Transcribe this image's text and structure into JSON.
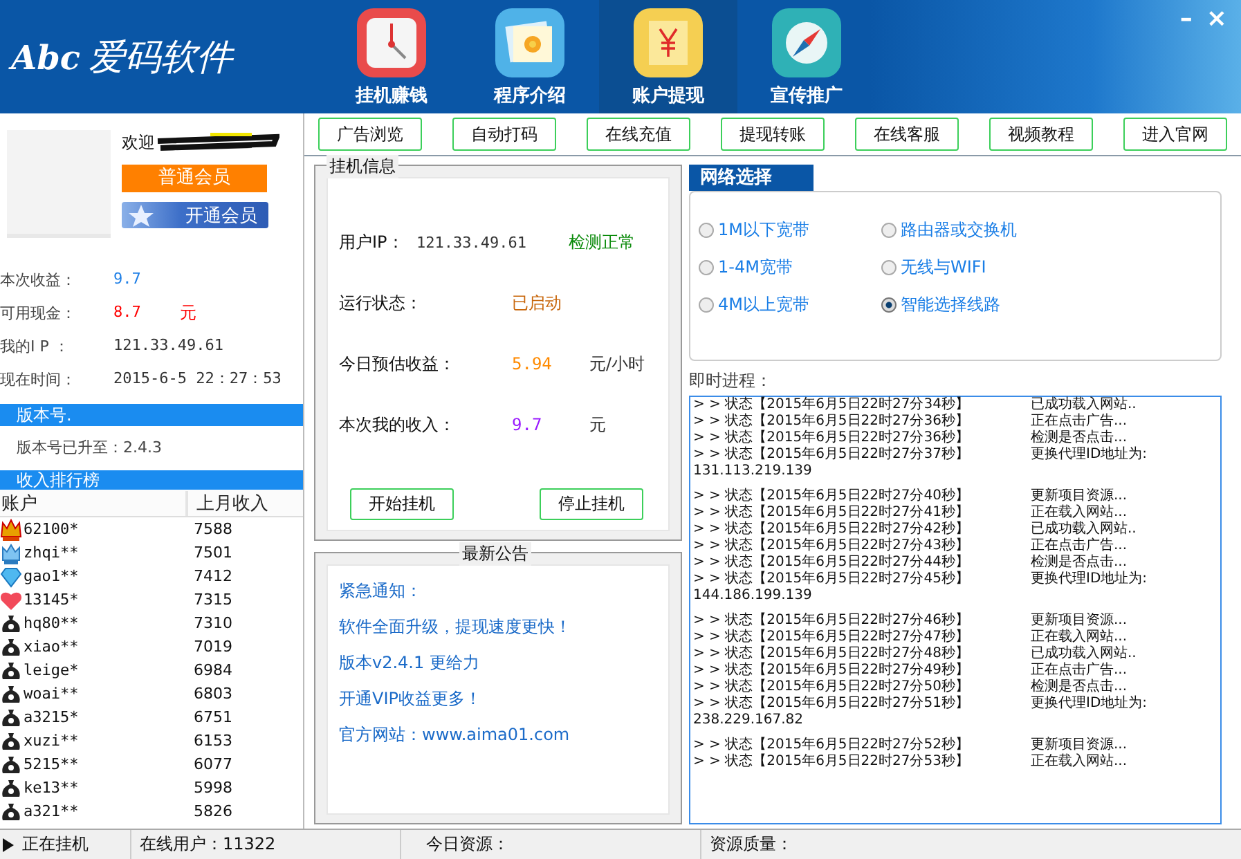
{
  "window": {
    "controls": [
      "–",
      "×"
    ]
  },
  "app": {
    "logo_mark": "Abc",
    "name": "爱码软件"
  },
  "nav": [
    {
      "label": "挂机赚钱",
      "kind": "clock",
      "selected": false
    },
    {
      "label": "程序介绍",
      "kind": "photo",
      "selected": false
    },
    {
      "label": "账户提现",
      "kind": "yen",
      "selected": true
    },
    {
      "label": "宣传推广",
      "kind": "compass",
      "selected": false
    }
  ],
  "toolbar": [
    "广告浏览",
    "自动打码",
    "在线充值",
    "提现转账",
    "在线客服",
    "视频教程",
    "进入官网"
  ],
  "user": {
    "greeting": "欢迎",
    "member_level": "普通会员",
    "upgrade_button": "开通会员",
    "stats": [
      {
        "label": "本次收益：",
        "value": "9.7",
        "color": "#1e7fe6"
      },
      {
        "label": "可用现金：",
        "value": "8.7",
        "unit": "元",
        "color": "#ff0000"
      },
      {
        "label": "我的I P ：",
        "value": "121.33.49.61",
        "color": "#333333"
      },
      {
        "label": "现在时间：",
        "value": "2015-6-5 22：27：53",
        "color": "#333333"
      }
    ]
  },
  "version": {
    "title": "版本号.",
    "text": "版本号已升至：2.4.3"
  },
  "ranking": {
    "title": "收入排行榜",
    "columns": [
      "账户",
      "上月收入"
    ],
    "rows": [
      {
        "kind": "gold-crown",
        "account": "62100*",
        "income": "7588"
      },
      {
        "kind": "blue-crown",
        "account": "zhqi**",
        "income": "7501"
      },
      {
        "kind": "diamond",
        "account": "gao1**",
        "income": "7412"
      },
      {
        "kind": "heart",
        "account": "13145*",
        "income": "7315"
      },
      {
        "kind": "bag",
        "account": "hq80**",
        "income": "7310"
      },
      {
        "kind": "bag",
        "account": "xiao**",
        "income": "7019"
      },
      {
        "kind": "bag",
        "account": "leige*",
        "income": "6984"
      },
      {
        "kind": "bag",
        "account": "woai**",
        "income": "6803"
      },
      {
        "kind": "bag",
        "account": "a3215*",
        "income": "6751"
      },
      {
        "kind": "bag",
        "account": "xuzi**",
        "income": "6153"
      },
      {
        "kind": "bag",
        "account": "5215**",
        "income": "6077"
      },
      {
        "kind": "bag",
        "account": "ke13**",
        "income": "5998"
      },
      {
        "kind": "bag",
        "account": "a321**",
        "income": "5826"
      }
    ]
  },
  "hangup": {
    "title": "挂机信息",
    "rows": [
      {
        "kind": "status",
        "label": "用户IP：",
        "value": "121.33.49.61",
        "color": "#333333",
        "unit": "检测正常"
      },
      {
        "kind": "plain",
        "label": "运行状态：",
        "value": "已启动",
        "color": "#c8660a"
      },
      {
        "kind": "plain",
        "label": "今日预估收益：",
        "value": "5.94",
        "color": "#ff8a00",
        "unit": "元/小时"
      },
      {
        "kind": "plain",
        "label": "本次我的收入：",
        "value": "9.7",
        "color": "#9a1aff",
        "unit": "元"
      }
    ],
    "buttons": [
      "开始挂机",
      "停止挂机"
    ]
  },
  "notice": {
    "title": "最新公告",
    "lines": [
      "紧急通知：",
      "软件全面升级，提现速度更快！",
      "版本v2.4.1 更给力",
      "开通VIP收益更多！",
      "官方网站：www.aima01.com"
    ]
  },
  "network": {
    "tab": "网络选择",
    "options": [
      {
        "label": "1M以下宽带",
        "selected": false
      },
      {
        "label": "路由器或交换机",
        "selected": false
      },
      {
        "label": "1-4M宽带",
        "selected": false
      },
      {
        "label": "无线与WIFI",
        "selected": false
      },
      {
        "label": "4M以上宽带",
        "selected": false
      },
      {
        "label": "智能选择线路",
        "selected": true
      }
    ]
  },
  "log": {
    "title": "即时进程：",
    "groups": [
      {
        "entries": [
          {
            "status": "> > 状态【2015年6月5日22时27分34秒】",
            "message": "已成功载入网站.."
          },
          {
            "status": "> > 状态【2015年6月5日22时27分36秒】",
            "message": "正在点击广告..."
          },
          {
            "status": "> > 状态【2015年6月5日22时27分36秒】",
            "message": "检测是否点击..."
          },
          {
            "status": "> > 状态【2015年6月5日22时27分37秒】",
            "message": "更换代理ID地址为:"
          }
        ],
        "address": "131.113.219.139"
      },
      {
        "entries": [
          {
            "status": "> > 状态【2015年6月5日22时27分40秒】",
            "message": "更新项目资源..."
          },
          {
            "status": "> > 状态【2015年6月5日22时27分41秒】",
            "message": "正在载入网站..."
          },
          {
            "status": "> > 状态【2015年6月5日22时27分42秒】",
            "message": "已成功载入网站.."
          },
          {
            "status": "> > 状态【2015年6月5日22时27分43秒】",
            "message": "正在点击广告..."
          },
          {
            "status": "> > 状态【2015年6月5日22时27分44秒】",
            "message": "检测是否点击..."
          },
          {
            "status": "> > 状态【2015年6月5日22时27分45秒】",
            "message": "更换代理ID地址为:"
          }
        ],
        "address": "144.186.199.139"
      },
      {
        "entries": [
          {
            "status": "> > 状态【2015年6月5日22时27分46秒】",
            "message": "更新项目资源..."
          },
          {
            "status": "> > 状态【2015年6月5日22时27分47秒】",
            "message": "正在载入网站..."
          },
          {
            "status": "> > 状态【2015年6月5日22时27分48秒】",
            "message": "已成功载入网站.."
          },
          {
            "status": "> > 状态【2015年6月5日22时27分49秒】",
            "message": "正在点击广告..."
          },
          {
            "status": "> > 状态【2015年6月5日22时27分50秒】",
            "message": "检测是否点击..."
          },
          {
            "status": "> > 状态【2015年6月5日22时27分51秒】",
            "message": "更换代理ID地址为:"
          }
        ],
        "address": "238.229.167.82"
      },
      {
        "entries": [
          {
            "status": "> > 状态【2015年6月5日22时27分52秒】",
            "message": "更新项目资源..."
          },
          {
            "status": "> > 状态【2015年6月5日22时27分53秒】",
            "message": "正在载入网站..."
          }
        ]
      }
    ]
  },
  "status_bar": [
    {
      "kind": "running",
      "text": "正在挂机"
    },
    {
      "kind": "plain",
      "text": "在线用户：11322"
    },
    {
      "kind": "plain",
      "text": "今日资源："
    },
    {
      "kind": "plain",
      "text": "资源质量："
    }
  ]
}
